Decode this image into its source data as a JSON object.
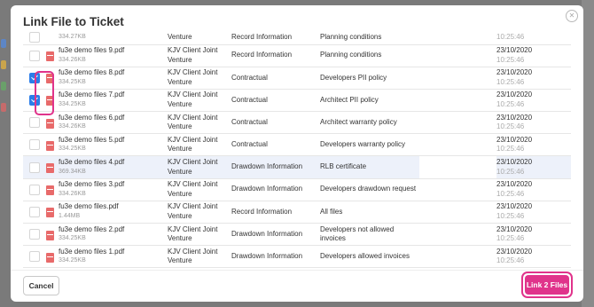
{
  "modal": {
    "title": "Link File to Ticket",
    "close_glyph": "✕",
    "cancel_label": "Cancel",
    "link_label": "Link 2 Files"
  },
  "colors": {
    "accent": "#e0338b",
    "checkbox_checked": "#2b7de9",
    "highlight_row": "#edf1fa",
    "pdf_icon": "#e86a6a"
  },
  "rows": [
    {
      "name": "",
      "size": "334.27KB",
      "property": "Venture",
      "type": "Record Information",
      "description": "Planning conditions",
      "date": "",
      "time": "10:25:46",
      "checked": false
    },
    {
      "name": "fu3e demo files 9.pdf",
      "size": "334.26KB",
      "property": "KJV Client Joint Venture",
      "type": "Record Information",
      "description": "Planning conditions",
      "date": "23/10/2020",
      "time": "10:25:46",
      "checked": false
    },
    {
      "name": "fu3e demo files 8.pdf",
      "size": "334.25KB",
      "property": "KJV Client Joint Venture",
      "type": "Contractual",
      "description": "Developers PII policy",
      "date": "23/10/2020",
      "time": "10:25:46",
      "checked": true
    },
    {
      "name": "fu3e demo files 7.pdf",
      "size": "334.25KB",
      "property": "KJV Client Joint Venture",
      "type": "Contractual",
      "description": "Architect PII policy",
      "date": "23/10/2020",
      "time": "10:25:46",
      "checked": true
    },
    {
      "name": "fu3e demo files 6.pdf",
      "size": "334.26KB",
      "property": "KJV Client Joint Venture",
      "type": "Contractual",
      "description": "Architect warranty policy",
      "date": "23/10/2020",
      "time": "10:25:46",
      "checked": false
    },
    {
      "name": "fu3e demo files 5.pdf",
      "size": "334.25KB",
      "property": "KJV Client Joint Venture",
      "type": "Contractual",
      "description": "Developers warranty policy",
      "date": "23/10/2020",
      "time": "10:25:46",
      "checked": false
    },
    {
      "name": "fu3e demo files 4.pdf",
      "size": "369.34KB",
      "property": "KJV Client Joint Venture",
      "type": "Drawdown Information",
      "description": "RLB certificate",
      "date": "23/10/2020",
      "time": "10:25:46",
      "checked": false
    },
    {
      "name": "fu3e demo files 3.pdf",
      "size": "334.26KB",
      "property": "KJV Client Joint Venture",
      "type": "Drawdown Information",
      "description": "Developers drawdown request",
      "date": "23/10/2020",
      "time": "10:25:46",
      "checked": false
    },
    {
      "name": "fu3e demo files.pdf",
      "size": "1.44MB",
      "property": "KJV Client Joint Venture",
      "type": "Record Information",
      "description": "All files",
      "date": "23/10/2020",
      "time": "10:25:46",
      "checked": false
    },
    {
      "name": "fu3e demo files 2.pdf",
      "size": "334.25KB",
      "property": "KJV Client Joint Venture",
      "type": "Drawdown Information",
      "description": "Developers not allowed invoices",
      "date": "23/10/2020",
      "time": "10:25:46",
      "checked": false
    },
    {
      "name": "fu3e demo files 1.pdf",
      "size": "334.25KB",
      "property": "KJV Client Joint Venture",
      "type": "Drawdown Information",
      "description": "Developers allowed invoices",
      "date": "23/10/2020",
      "time": "10:25:46",
      "checked": false
    }
  ]
}
